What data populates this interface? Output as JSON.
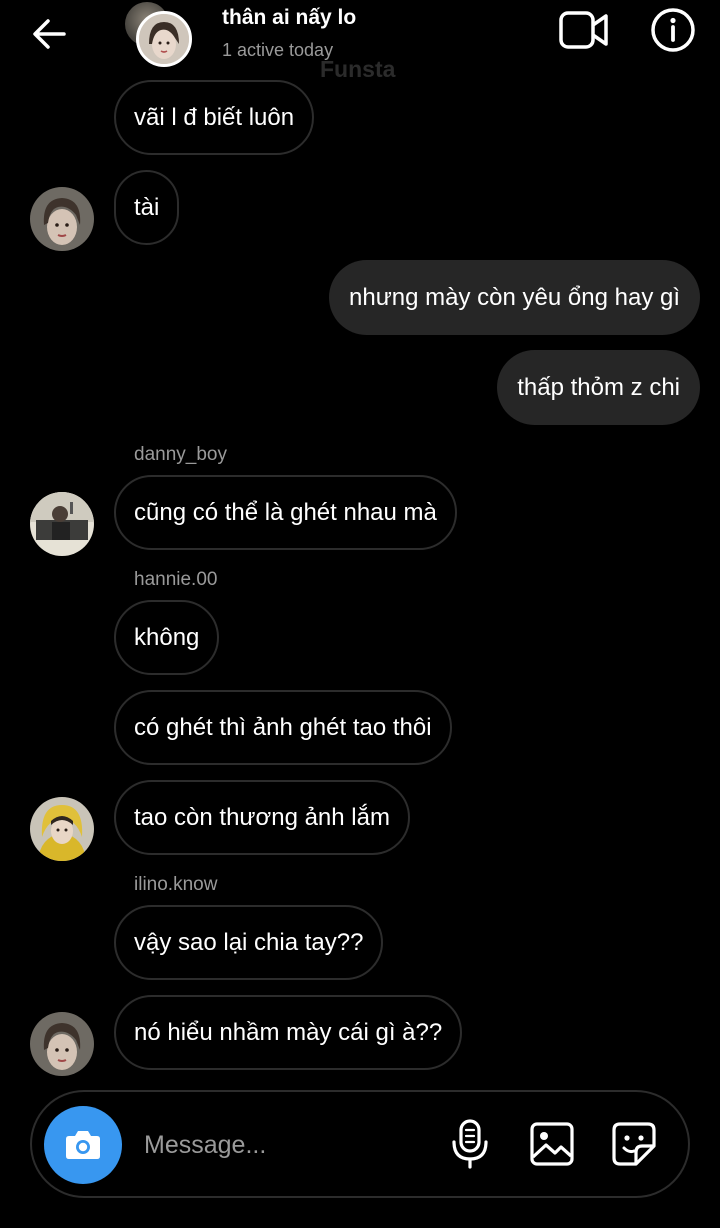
{
  "header": {
    "title": "thân ai nấy lo",
    "status": "1 active today",
    "watermark": "Funsta"
  },
  "messages": [
    {
      "type": "incoming",
      "text": "vãi l đ biết luôn"
    },
    {
      "type": "incoming",
      "text": "tài"
    },
    {
      "type": "outgoing",
      "text": "nhưng mày còn yêu ổng hay gì"
    },
    {
      "type": "outgoing",
      "text": "thấp thỏm z chi"
    },
    {
      "type": "incoming",
      "sender": "danny_boy",
      "text": "cũng có thể là ghét nhau mà"
    },
    {
      "type": "incoming",
      "sender": "hannie.00",
      "text": "không"
    },
    {
      "type": "incoming",
      "text": "có ghét thì ảnh ghét tao thôi"
    },
    {
      "type": "incoming",
      "text": "tao còn thương ảnh lắm"
    },
    {
      "type": "incoming",
      "sender": "ilino.know",
      "text": "vậy sao lại chia tay??"
    },
    {
      "type": "incoming",
      "text": "nó hiểu nhầm mày cái gì à??"
    }
  ],
  "composer": {
    "placeholder": "Message..."
  },
  "icons": {
    "back": "arrow-left-icon",
    "video": "video-camera-icon",
    "info": "info-icon",
    "camera": "camera-icon",
    "mic": "microphone-icon",
    "gallery": "image-icon",
    "sticker": "sticker-icon"
  },
  "colors": {
    "background": "#000000",
    "outgoing_bubble": "#262626",
    "incoming_border": "#2c2c2c",
    "accent": "#3897f0",
    "secondary_text": "#9a9a9a"
  }
}
